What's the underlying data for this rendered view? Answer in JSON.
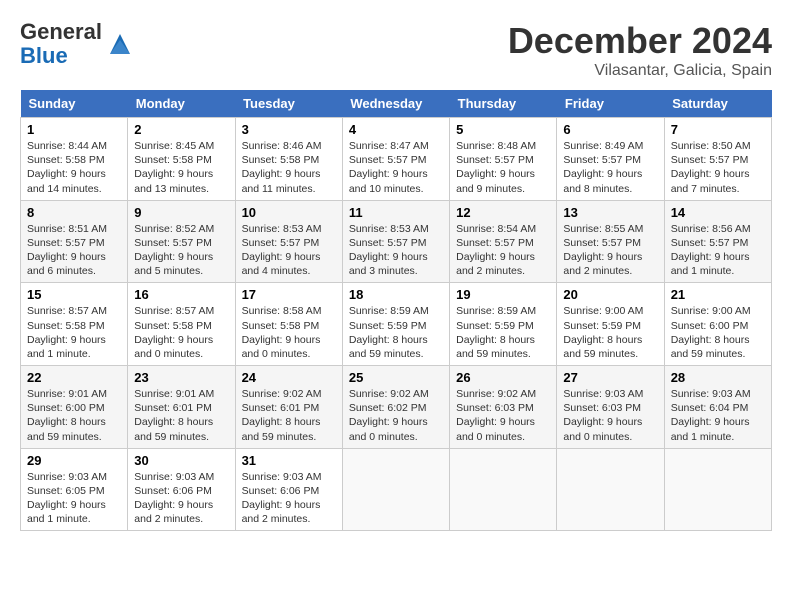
{
  "header": {
    "logo_general": "General",
    "logo_blue": "Blue",
    "month_title": "December 2024",
    "location": "Vilasantar, Galicia, Spain"
  },
  "weekdays": [
    "Sunday",
    "Monday",
    "Tuesday",
    "Wednesday",
    "Thursday",
    "Friday",
    "Saturday"
  ],
  "weeks": [
    [
      {
        "day": "1",
        "lines": [
          "Sunrise: 8:44 AM",
          "Sunset: 5:58 PM",
          "Daylight: 9 hours",
          "and 14 minutes."
        ]
      },
      {
        "day": "2",
        "lines": [
          "Sunrise: 8:45 AM",
          "Sunset: 5:58 PM",
          "Daylight: 9 hours",
          "and 13 minutes."
        ]
      },
      {
        "day": "3",
        "lines": [
          "Sunrise: 8:46 AM",
          "Sunset: 5:58 PM",
          "Daylight: 9 hours",
          "and 11 minutes."
        ]
      },
      {
        "day": "4",
        "lines": [
          "Sunrise: 8:47 AM",
          "Sunset: 5:57 PM",
          "Daylight: 9 hours",
          "and 10 minutes."
        ]
      },
      {
        "day": "5",
        "lines": [
          "Sunrise: 8:48 AM",
          "Sunset: 5:57 PM",
          "Daylight: 9 hours",
          "and 9 minutes."
        ]
      },
      {
        "day": "6",
        "lines": [
          "Sunrise: 8:49 AM",
          "Sunset: 5:57 PM",
          "Daylight: 9 hours",
          "and 8 minutes."
        ]
      },
      {
        "day": "7",
        "lines": [
          "Sunrise: 8:50 AM",
          "Sunset: 5:57 PM",
          "Daylight: 9 hours",
          "and 7 minutes."
        ]
      }
    ],
    [
      {
        "day": "8",
        "lines": [
          "Sunrise: 8:51 AM",
          "Sunset: 5:57 PM",
          "Daylight: 9 hours",
          "and 6 minutes."
        ]
      },
      {
        "day": "9",
        "lines": [
          "Sunrise: 8:52 AM",
          "Sunset: 5:57 PM",
          "Daylight: 9 hours",
          "and 5 minutes."
        ]
      },
      {
        "day": "10",
        "lines": [
          "Sunrise: 8:53 AM",
          "Sunset: 5:57 PM",
          "Daylight: 9 hours",
          "and 4 minutes."
        ]
      },
      {
        "day": "11",
        "lines": [
          "Sunrise: 8:53 AM",
          "Sunset: 5:57 PM",
          "Daylight: 9 hours",
          "and 3 minutes."
        ]
      },
      {
        "day": "12",
        "lines": [
          "Sunrise: 8:54 AM",
          "Sunset: 5:57 PM",
          "Daylight: 9 hours",
          "and 2 minutes."
        ]
      },
      {
        "day": "13",
        "lines": [
          "Sunrise: 8:55 AM",
          "Sunset: 5:57 PM",
          "Daylight: 9 hours",
          "and 2 minutes."
        ]
      },
      {
        "day": "14",
        "lines": [
          "Sunrise: 8:56 AM",
          "Sunset: 5:57 PM",
          "Daylight: 9 hours",
          "and 1 minute."
        ]
      }
    ],
    [
      {
        "day": "15",
        "lines": [
          "Sunrise: 8:57 AM",
          "Sunset: 5:58 PM",
          "Daylight: 9 hours",
          "and 1 minute."
        ]
      },
      {
        "day": "16",
        "lines": [
          "Sunrise: 8:57 AM",
          "Sunset: 5:58 PM",
          "Daylight: 9 hours",
          "and 0 minutes."
        ]
      },
      {
        "day": "17",
        "lines": [
          "Sunrise: 8:58 AM",
          "Sunset: 5:58 PM",
          "Daylight: 9 hours",
          "and 0 minutes."
        ]
      },
      {
        "day": "18",
        "lines": [
          "Sunrise: 8:59 AM",
          "Sunset: 5:59 PM",
          "Daylight: 8 hours",
          "and 59 minutes."
        ]
      },
      {
        "day": "19",
        "lines": [
          "Sunrise: 8:59 AM",
          "Sunset: 5:59 PM",
          "Daylight: 8 hours",
          "and 59 minutes."
        ]
      },
      {
        "day": "20",
        "lines": [
          "Sunrise: 9:00 AM",
          "Sunset: 5:59 PM",
          "Daylight: 8 hours",
          "and 59 minutes."
        ]
      },
      {
        "day": "21",
        "lines": [
          "Sunrise: 9:00 AM",
          "Sunset: 6:00 PM",
          "Daylight: 8 hours",
          "and 59 minutes."
        ]
      }
    ],
    [
      {
        "day": "22",
        "lines": [
          "Sunrise: 9:01 AM",
          "Sunset: 6:00 PM",
          "Daylight: 8 hours",
          "and 59 minutes."
        ]
      },
      {
        "day": "23",
        "lines": [
          "Sunrise: 9:01 AM",
          "Sunset: 6:01 PM",
          "Daylight: 8 hours",
          "and 59 minutes."
        ]
      },
      {
        "day": "24",
        "lines": [
          "Sunrise: 9:02 AM",
          "Sunset: 6:01 PM",
          "Daylight: 8 hours",
          "and 59 minutes."
        ]
      },
      {
        "day": "25",
        "lines": [
          "Sunrise: 9:02 AM",
          "Sunset: 6:02 PM",
          "Daylight: 9 hours",
          "and 0 minutes."
        ]
      },
      {
        "day": "26",
        "lines": [
          "Sunrise: 9:02 AM",
          "Sunset: 6:03 PM",
          "Daylight: 9 hours",
          "and 0 minutes."
        ]
      },
      {
        "day": "27",
        "lines": [
          "Sunrise: 9:03 AM",
          "Sunset: 6:03 PM",
          "Daylight: 9 hours",
          "and 0 minutes."
        ]
      },
      {
        "day": "28",
        "lines": [
          "Sunrise: 9:03 AM",
          "Sunset: 6:04 PM",
          "Daylight: 9 hours",
          "and 1 minute."
        ]
      }
    ],
    [
      {
        "day": "29",
        "lines": [
          "Sunrise: 9:03 AM",
          "Sunset: 6:05 PM",
          "Daylight: 9 hours",
          "and 1 minute."
        ]
      },
      {
        "day": "30",
        "lines": [
          "Sunrise: 9:03 AM",
          "Sunset: 6:06 PM",
          "Daylight: 9 hours",
          "and 2 minutes."
        ]
      },
      {
        "day": "31",
        "lines": [
          "Sunrise: 9:03 AM",
          "Sunset: 6:06 PM",
          "Daylight: 9 hours",
          "and 2 minutes."
        ]
      },
      null,
      null,
      null,
      null
    ]
  ]
}
